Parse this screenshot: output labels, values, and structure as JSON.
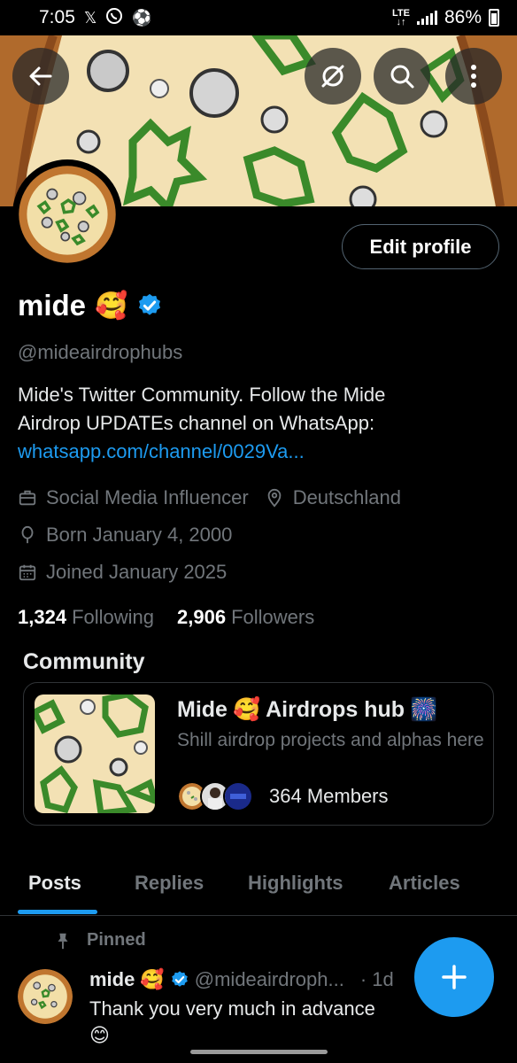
{
  "status_bar": {
    "time": "7:05",
    "app_icons": [
      "x-icon",
      "whatsapp-icon",
      "soccer-ball-icon"
    ],
    "network": "LTE",
    "battery": "86%"
  },
  "header": {
    "back_icon": "arrow-left-icon",
    "actions": [
      "grok-icon",
      "search-icon",
      "more-vertical-icon"
    ]
  },
  "profile": {
    "edit_label": "Edit profile",
    "name": "mide",
    "name_emoji": "🥰",
    "handle": "@mideairdrophubs",
    "bio_line1": "Mide's Twitter Community.  Follow the Mide",
    "bio_line2": "Airdrop UPDATEs channel on WhatsApp:",
    "bio_link": "whatsapp.com/channel/0029Va...",
    "category": "Social Media Influencer",
    "location": "Deutschland",
    "born": "Born January 4, 2000",
    "joined": "Joined January 2025",
    "following_count": "1,324",
    "following_label": "Following",
    "followers_count": "2,906",
    "followers_label": "Followers"
  },
  "community": {
    "section_title": "Community",
    "name": "Mide",
    "name_emoji": "🥰",
    "name_rest": "Airdrops hub",
    "name_suffix_emoji": "🎆",
    "description": "Shill airdrop projects and alphas here",
    "members": "364 Members"
  },
  "tabs": [
    {
      "label": "Posts",
      "active": true
    },
    {
      "label": "Replies",
      "active": false
    },
    {
      "label": "Highlights",
      "active": false
    },
    {
      "label": "Articles",
      "active": false
    }
  ],
  "pinned_post": {
    "pinned_label": "Pinned",
    "name": "mide",
    "name_emoji": "🥰",
    "handle": "@mideairdroph...",
    "time": "· 1d",
    "text": "Thank you very much in advance",
    "text_emoji": "😊"
  },
  "colors": {
    "accent": "#1d9bf0",
    "background": "#000000",
    "muted_text": "#71767b",
    "border": "#2f3336"
  }
}
